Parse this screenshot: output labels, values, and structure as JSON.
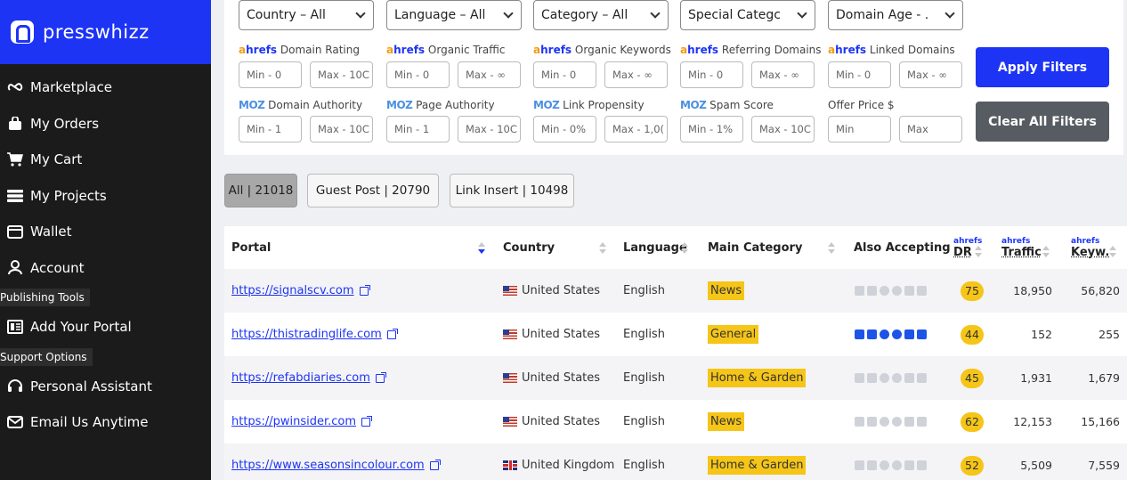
{
  "brand": {
    "name": "presswhizz"
  },
  "sidebar": {
    "items": [
      {
        "label": "Marketplace",
        "icon": "marketplace-icon"
      },
      {
        "label": "My Orders",
        "icon": "bag-icon"
      },
      {
        "label": "My Cart",
        "icon": "cart-icon"
      },
      {
        "label": "My Projects",
        "icon": "projects-icon"
      },
      {
        "label": "Wallet",
        "icon": "wallet-icon"
      },
      {
        "label": "Account",
        "icon": "user-icon"
      }
    ],
    "publishing_label": "Publishing Tools",
    "publishing_items": [
      {
        "label": "Add Your Portal",
        "icon": "portal-icon"
      }
    ],
    "support_label": "Support Options",
    "support_items": [
      {
        "label": "Personal Assistant",
        "icon": "headset-icon"
      },
      {
        "label": "Email Us Anytime",
        "icon": "mail-icon"
      }
    ]
  },
  "filters": {
    "selects": [
      "Country – All",
      "Language – All",
      "Category – All",
      "Special Categc",
      "Domain Age - ."
    ],
    "row1_labels": [
      {
        "brand": "ahrefs",
        "text": "Domain Rating"
      },
      {
        "brand": "ahrefs",
        "text": "Organic Traffic"
      },
      {
        "brand": "ahrefs",
        "text": "Organic Keywords"
      },
      {
        "brand": "ahrefs",
        "text": "Referring Domains"
      },
      {
        "brand": "ahrefs",
        "text": "Linked Domains"
      }
    ],
    "row1_inputs": [
      [
        "Min - 0",
        "Max - 10C"
      ],
      [
        "Min - 0",
        "Max - ∞"
      ],
      [
        "Min - 0",
        "Max - ∞"
      ],
      [
        "Min - 0",
        "Max - ∞"
      ],
      [
        "Min - 0",
        "Max - ∞"
      ]
    ],
    "row2_labels": [
      {
        "brand": "MOZ",
        "text": "Domain Authority"
      },
      {
        "brand": "MOZ",
        "text": "Page Authority"
      },
      {
        "brand": "MOZ",
        "text": "Link Propensity"
      },
      {
        "brand": "MOZ",
        "text": "Spam Score"
      },
      {
        "brand": "",
        "text": "Offer Price $"
      }
    ],
    "row2_inputs": [
      [
        "Min - 1",
        "Max - 10C"
      ],
      [
        "Min - 1",
        "Max - 10C"
      ],
      [
        "Min - 0%",
        "Max - 1,0("
      ],
      [
        "Min - 1%",
        "Max - 10C"
      ],
      [
        "Min",
        "Max"
      ]
    ],
    "apply_label": "Apply Filters",
    "clear_label": "Clear All Filters"
  },
  "tabs": [
    "All | 21018",
    "Guest Post | 20790",
    "Link Insert | 10498"
  ],
  "table": {
    "headers": {
      "portal": "Portal",
      "country": "Country",
      "language": "Language",
      "category": "Main Category",
      "accepting": "Also Accepting",
      "dr_brand": "ahrefs",
      "dr": "DR",
      "traffic_brand": "ahrefs",
      "traffic": "Traffic",
      "keyw_brand": "ahrefs",
      "keyw": "Keyw."
    },
    "rows": [
      {
        "portal": "https://signalscv.com",
        "flag": "us",
        "country": "United States",
        "language": "English",
        "category": "News",
        "accept_on": false,
        "dr": "75",
        "traffic": "18,950",
        "keyw": "56,820"
      },
      {
        "portal": "https://thistradinglife.com",
        "flag": "us",
        "country": "United States",
        "language": "English",
        "category": "General",
        "accept_on": true,
        "dr": "44",
        "traffic": "152",
        "keyw": "255"
      },
      {
        "portal": "https://refabdiaries.com",
        "flag": "us",
        "country": "United States",
        "language": "English",
        "category": "Home & Garden",
        "accept_on": false,
        "dr": "45",
        "traffic": "1,931",
        "keyw": "1,679"
      },
      {
        "portal": "https://pwinsider.com",
        "flag": "us",
        "country": "United States",
        "language": "English",
        "category": "News",
        "accept_on": false,
        "dr": "62",
        "traffic": "12,153",
        "keyw": "15,166"
      },
      {
        "portal": "https://www.seasonsincolour.com",
        "flag": "uk",
        "country": "United Kingdom",
        "language": "English",
        "category": "Home & Garden",
        "accept_on": false,
        "dr": "52",
        "traffic": "5,509",
        "keyw": "7,559"
      }
    ]
  }
}
